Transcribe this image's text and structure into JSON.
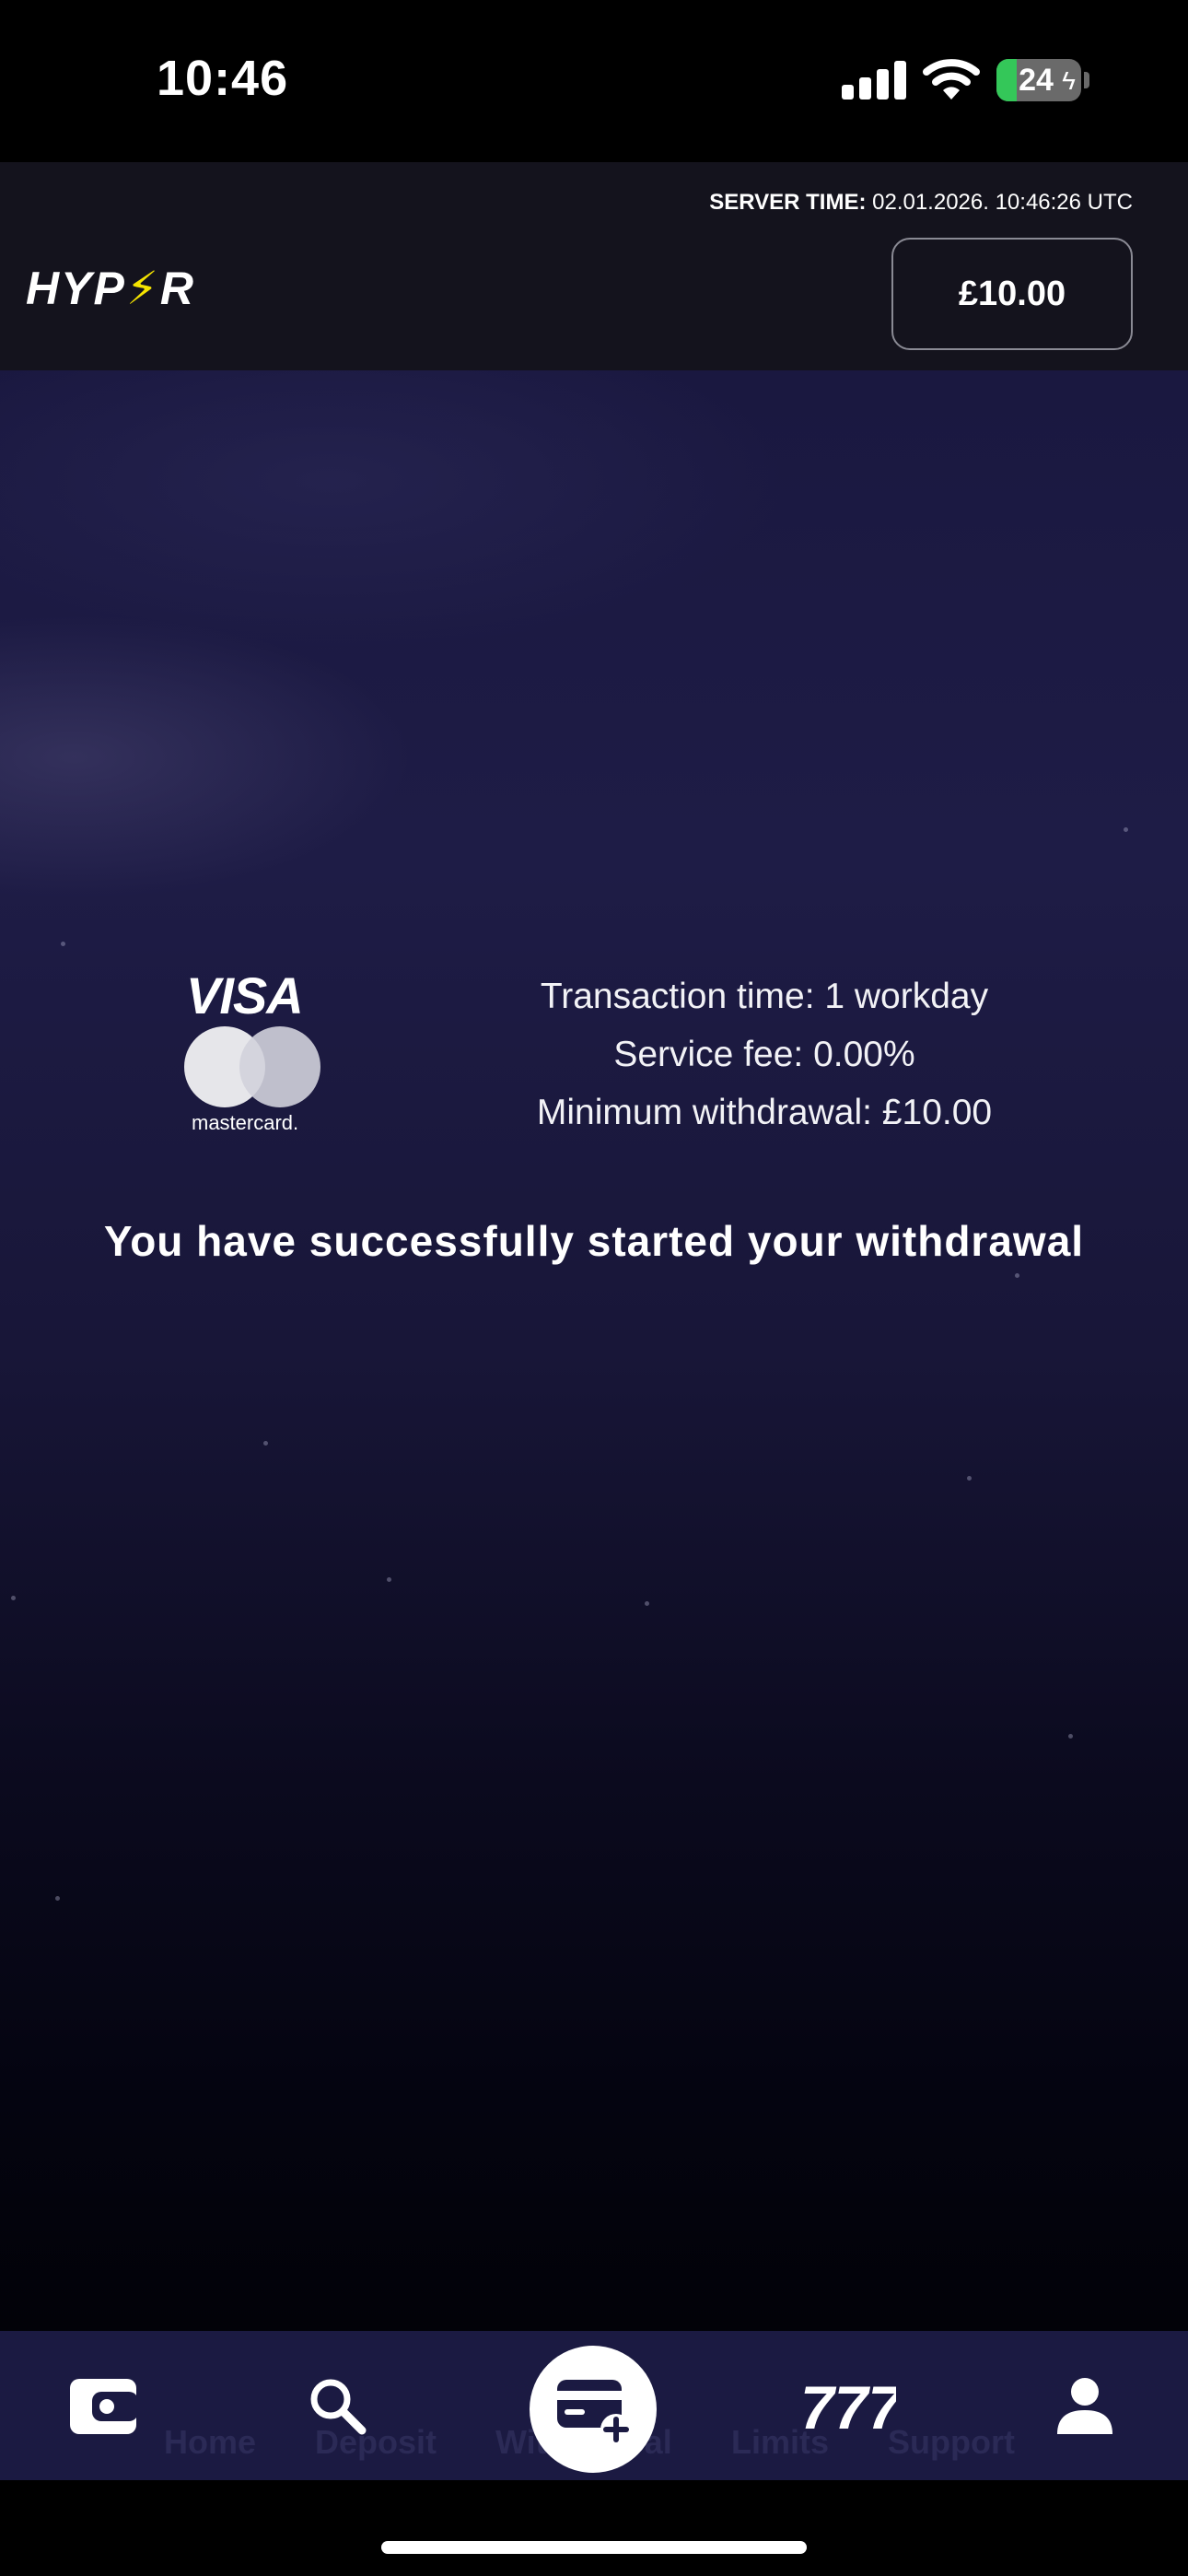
{
  "status_bar": {
    "time": "10:46",
    "battery_level": "24",
    "battery_fraction": 0.24
  },
  "header": {
    "server_time_label": "SERVER TIME:",
    "server_time_value": "02.01.2026. 10:46:26 UTC",
    "logo_prefix": "HYP",
    "logo_bolt": "⚡",
    "logo_suffix": "R",
    "balance": "£10.00"
  },
  "payment": {
    "visa_label": "VISA",
    "mastercard_label": "mastercard.",
    "transaction_time": "Transaction time: 1 workday",
    "service_fee": "Service fee: 0.00%",
    "minimum_withdrawal": "Minimum withdrawal: £10.00"
  },
  "message": "You have successfully started your withdrawal",
  "nav": {
    "labels": [
      "Home",
      "Deposit",
      "Withdrawal",
      "Limits",
      "Support"
    ],
    "icons": [
      "wallet-icon",
      "search-icon",
      "card-plus-icon",
      "slots-777-icon",
      "user-icon"
    ]
  },
  "colors": {
    "background": "#1a1840",
    "nav_background": "#1b1a42",
    "logo_bolt": "#f5e400",
    "battery": "#34c759"
  }
}
